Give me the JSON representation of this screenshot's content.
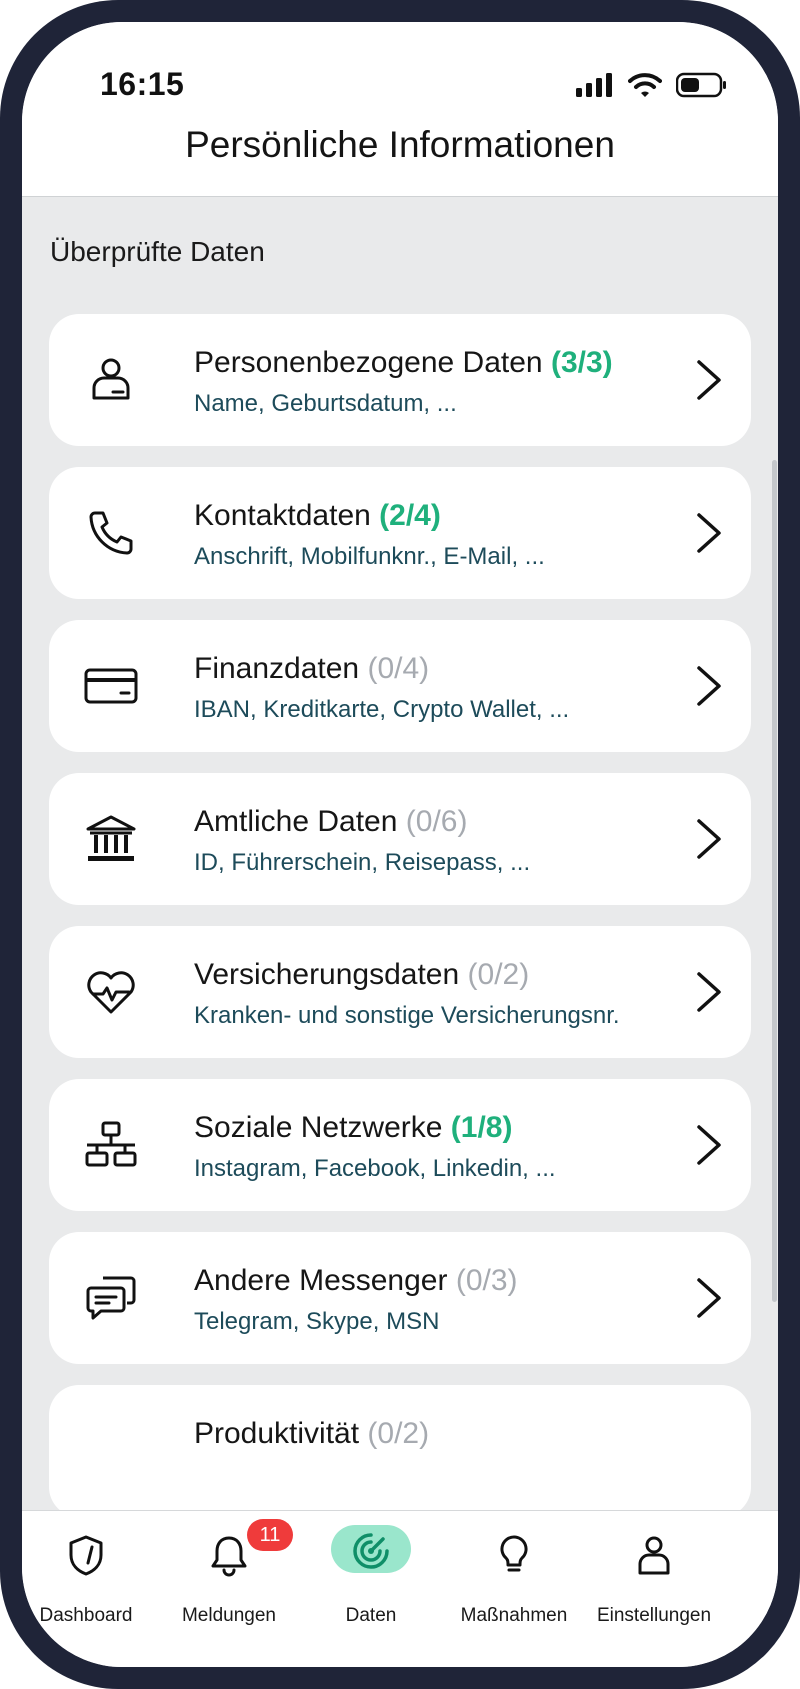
{
  "status_bar": {
    "time": "16:15"
  },
  "header": {
    "title": "Persönliche Informationen"
  },
  "section": {
    "title": "Überprüfte Daten"
  },
  "cards": [
    {
      "title": "Personenbezogene Daten",
      "count": "(3/3)",
      "count_color": "#1fb07c",
      "subtitle": "Name, Geburtsdatum, ...",
      "icon": "person-icon"
    },
    {
      "title": "Kontaktdaten",
      "count": "(2/4)",
      "count_color": "#1fb07c",
      "subtitle": "Anschrift, Mobilfunknr., E-Mail, ...",
      "icon": "phone-icon"
    },
    {
      "title": "Finanzdaten",
      "count": "(0/4)",
      "count_color": "#a6aab0",
      "subtitle": "IBAN, Kreditkarte, Crypto Wallet, ...",
      "icon": "credit-card-icon"
    },
    {
      "title": "Amtliche Daten",
      "count": "(0/6)",
      "count_color": "#a6aab0",
      "subtitle": "ID, Führerschein, Reisepass, ...",
      "icon": "bank-building-icon"
    },
    {
      "title": "Versicherungsdaten",
      "count": "(0/2)",
      "count_color": "#a6aab0",
      "subtitle": "Kranken- und sonstige Versicherungsnr.",
      "icon": "heart-pulse-icon"
    },
    {
      "title": "Soziale Netzwerke",
      "count": "(1/8)",
      "count_color": "#1fb07c",
      "subtitle": "Instagram, Facebook, Linkedin, ...",
      "icon": "network-icon"
    },
    {
      "title": "Andere Messenger",
      "count": "(0/3)",
      "count_color": "#a6aab0",
      "subtitle": "Telegram, Skype, MSN",
      "icon": "chat-bubbles-icon"
    },
    {
      "title": "Produktivität",
      "count": "(0/2)",
      "count_color": "#a6aab0",
      "subtitle": "",
      "icon": ""
    }
  ],
  "tabbar": {
    "tabs": [
      {
        "label": "Dashboard",
        "icon": "shield-icon"
      },
      {
        "label": "Meldungen",
        "icon": "bell-icon",
        "badge": "11"
      },
      {
        "label": "Daten",
        "icon": "radar-icon",
        "active": true
      },
      {
        "label": "Maßnahmen",
        "icon": "lightbulb-icon"
      },
      {
        "label": "Einstellungen",
        "icon": "person-icon"
      }
    ]
  },
  "colors": {
    "accent_green": "#1fb07c",
    "badge_red": "#ef3b3b",
    "active_pill": "#9ae6cc",
    "subtitle_text": "#1d4b5a"
  }
}
